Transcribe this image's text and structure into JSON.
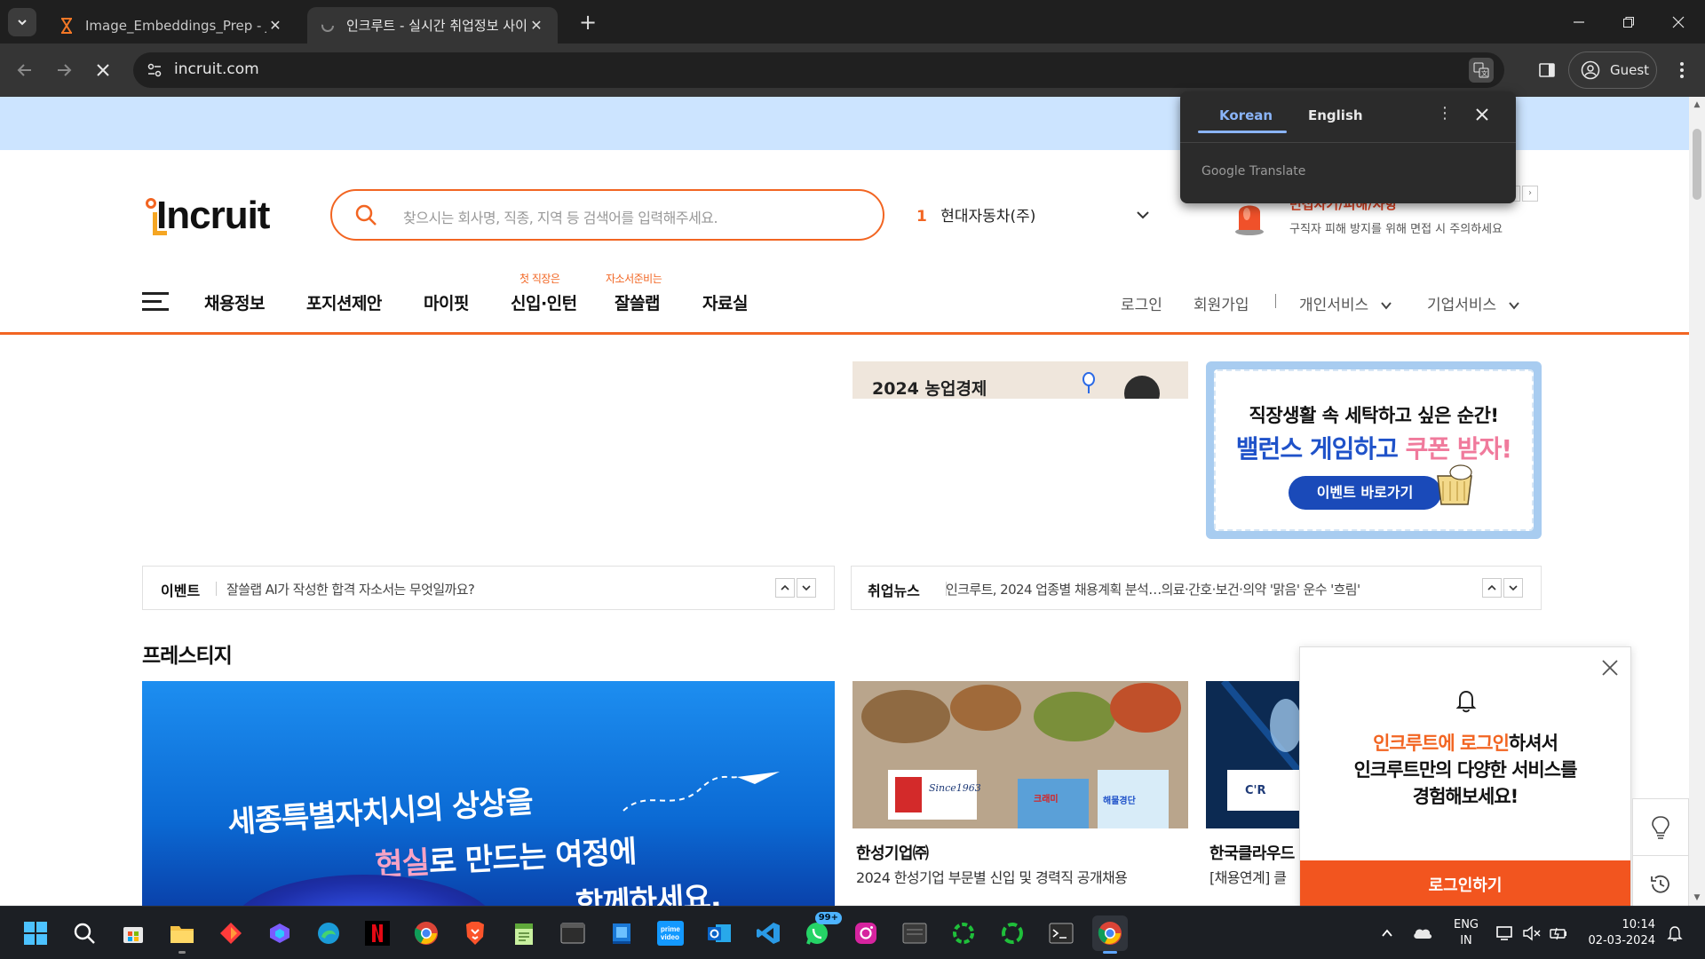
{
  "browser": {
    "tabs": [
      {
        "title": "Image_Embeddings_Prep - Jupy",
        "favicon": "hourglass-icon",
        "active": false
      },
      {
        "title": "인크루트 - 실시간 취업정보 사이",
        "favicon": "loading-icon",
        "active": true
      }
    ],
    "url": "incruit.com",
    "profile_label": "Guest"
  },
  "translate_popup": {
    "source_lang": "Korean",
    "target_lang": "English",
    "branding": "Google Translate"
  },
  "header": {
    "logo_text": "Incruit",
    "search_placeholder": "찾으시는 회사명, 직종, 지역 등 검색어를 입력해주세요.",
    "ranking": {
      "rank": "1",
      "company": "현대자동차(주)"
    },
    "notice": {
      "title": "면접사기/피해/사항",
      "subtitle": "구직자 피해 방지를 위해 면접 시 주의하세요"
    }
  },
  "gnb": {
    "items": [
      {
        "label": "채용정보",
        "sup": ""
      },
      {
        "label": "포지션제안",
        "sup": ""
      },
      {
        "label": "마이핏",
        "sup": ""
      },
      {
        "label": "신입·인턴",
        "sup": "첫 직장은"
      },
      {
        "label": "잘쓸랩",
        "sup": "자소서준비는"
      },
      {
        "label": "자료실",
        "sup": ""
      }
    ],
    "right": {
      "login": "로그인",
      "signup": "회원가입",
      "personal": "개인서비스",
      "corporate": "기업서비스"
    }
  },
  "banners": {
    "strip_text": "2024 농업경제",
    "event_card": {
      "line1": "직장생활 속 세탁하고 싶은 순간!",
      "line2_blue": "밸런스 게임하고 ",
      "line2_pink": "쿠폰 받자!",
      "cta": "이벤트 바로가기"
    }
  },
  "tickers": [
    {
      "label": "이벤트",
      "text": "잘쓸랩 AI가 작성한 합격 자소서는 무엇일까요?"
    },
    {
      "label": "취업뉴스",
      "text": "인크루트, 2024 업종별 채용계획 분석…의료·간호·보건·의약 '맑음' 운수 '흐림'"
    }
  ],
  "prestige": {
    "title": "프레스티지",
    "hero": {
      "line1": "세종특별자치시의 상상을",
      "line2_pink": "현실",
      "line2_rest": "로 만드는 여정에",
      "line3": "함께하세요."
    },
    "cards": [
      {
        "name": "한성기업㈜",
        "sub": "2024 한성기업 부문별 신입 및 경력직 공개채용",
        "logo_label": "Since1963",
        "products": [
          "크래미",
          "해물경단"
        ]
      },
      {
        "name": "한국클라우드",
        "sub": "[채용연계] 클",
        "logo_label": "C'R"
      }
    ]
  },
  "login_popup": {
    "line1_highlight": "인크루트에 로그인",
    "line1_rest": "하셔서",
    "line2": "인크루트만의 다양한 서비스를",
    "line3": "경험해보세요!",
    "button": "로그인하기"
  },
  "taskbar": {
    "apps": [
      "start-icon",
      "search-icon",
      "store-icon",
      "file-explorer-icon",
      "app-red-icon",
      "copilot-icon",
      "edge-icon",
      "netflix-icon",
      "chrome-icon",
      "brave-icon",
      "notepad-icon",
      "terminal-icon",
      "app-blue-icon",
      "prime-video-icon",
      "outlook-icon",
      "vscode-icon",
      "whatsapp-icon",
      "instagram-icon",
      "app-gray-icon",
      "app-green-ring-icon",
      "app-green-ring2-icon",
      "cmd-icon",
      "chrome-active-icon"
    ],
    "whatsapp_badge": "99+",
    "lang_line1": "ENG",
    "lang_line2": "IN",
    "time": "10:14",
    "date": "02-03-2024"
  }
}
